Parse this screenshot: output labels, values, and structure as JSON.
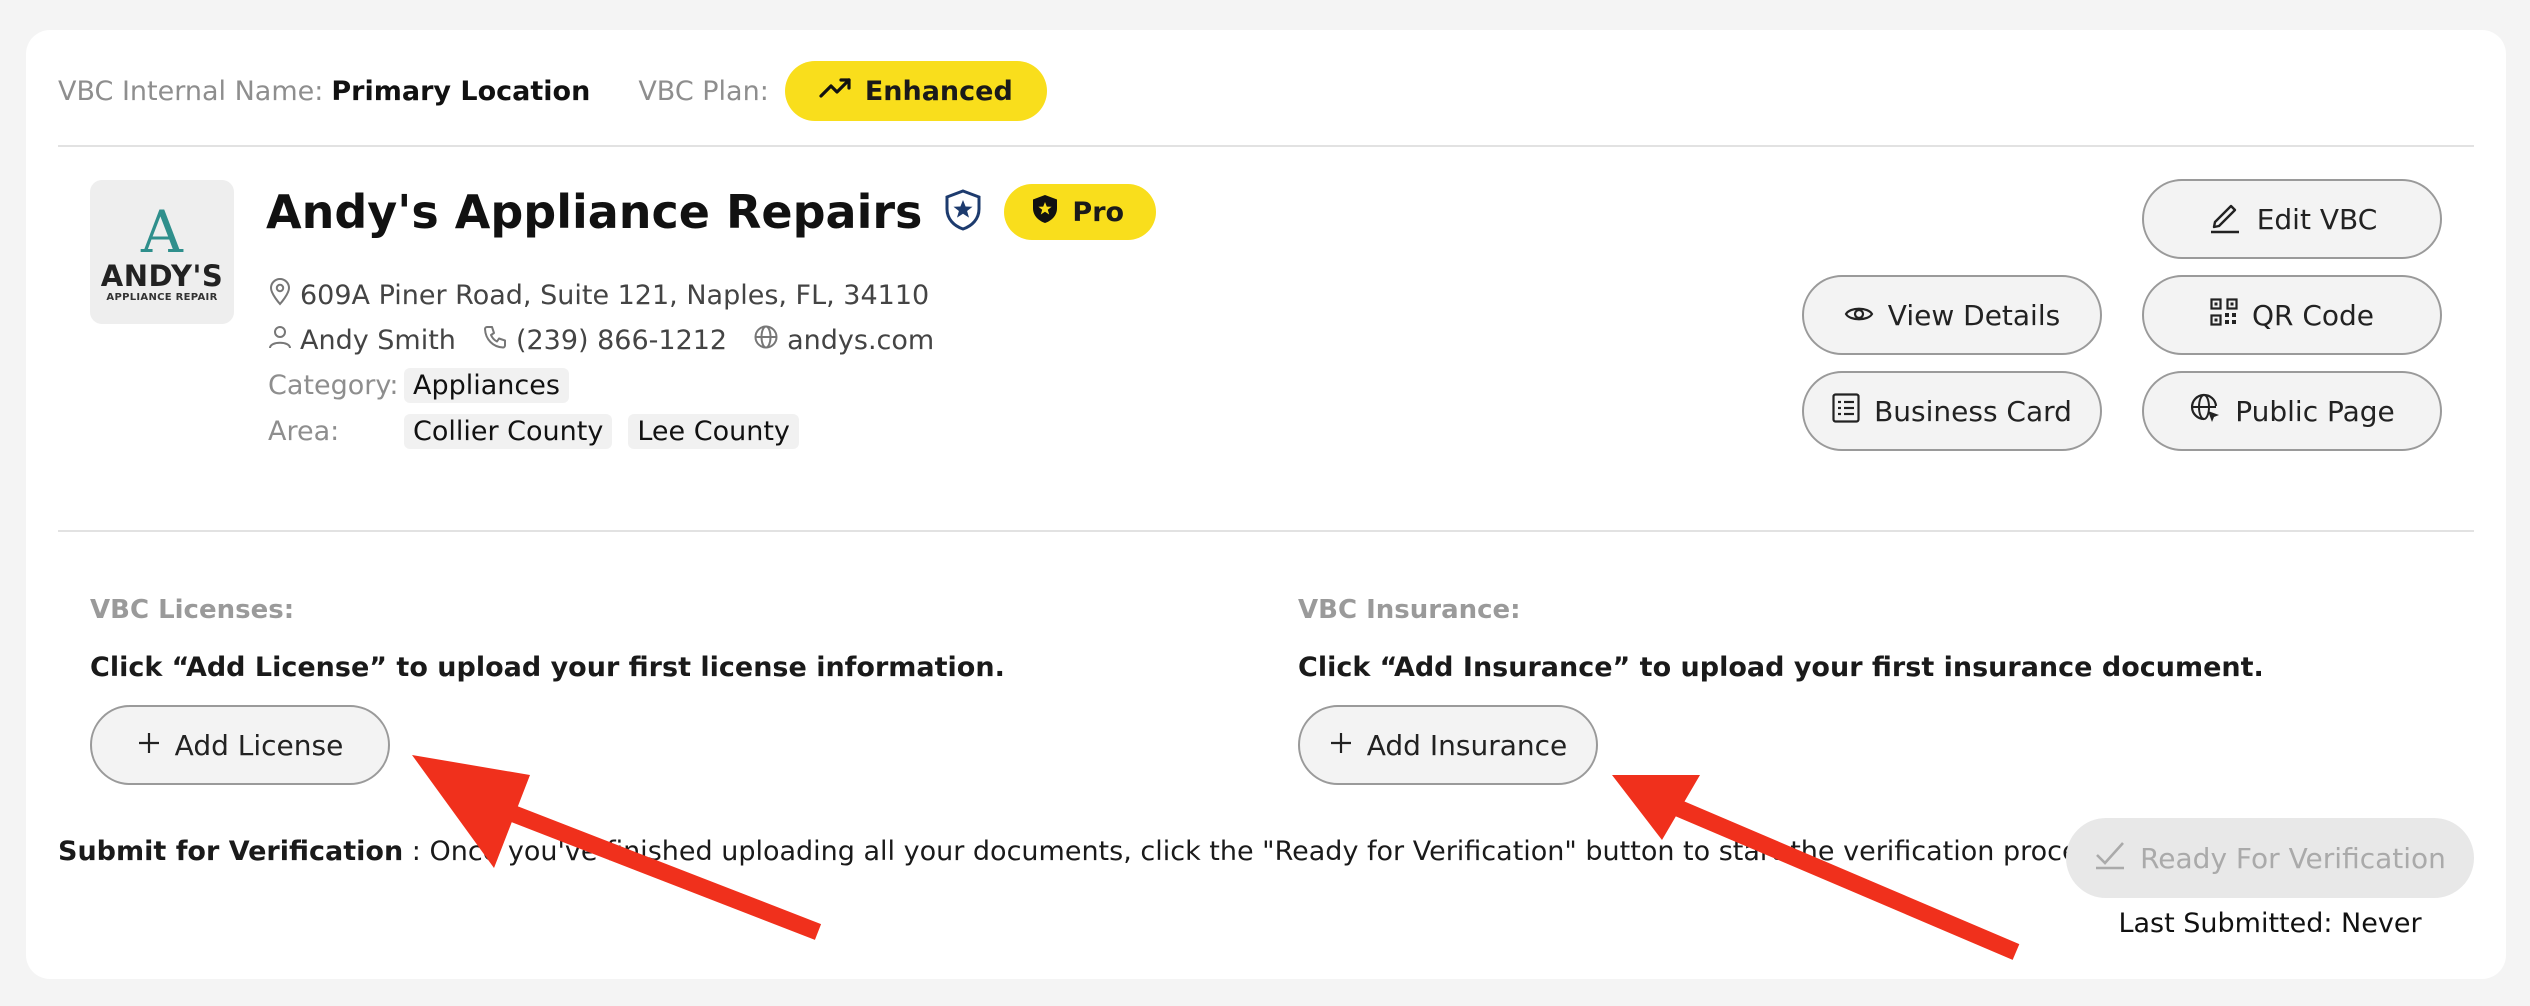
{
  "header": {
    "internal_name_label": "VBC Internal Name:",
    "internal_name_value": "Primary Location",
    "plan_label": "VBC Plan:",
    "plan_value": "Enhanced"
  },
  "business": {
    "logo_mark": "A",
    "logo_text_1": "ANDY'S",
    "logo_text_2": "APPLIANCE REPAIR",
    "name": "Andy's Appliance Repairs",
    "tier_badge": "Pro",
    "address": "609A Piner Road, Suite 121, Naples, FL, 34110",
    "contact_name": "Andy Smith",
    "phone": "(239) 866-1212",
    "website": "andys.com",
    "category_label": "Category:",
    "categories": [
      "Appliances"
    ],
    "area_label": "Area:",
    "areas": [
      "Collier County",
      "Lee County"
    ]
  },
  "actions": {
    "edit": "Edit VBC",
    "view_details": "View Details",
    "qr_code": "QR Code",
    "business_card": "Business Card",
    "public_page": "Public Page"
  },
  "licenses": {
    "label": "VBC Licenses:",
    "prompt": "Click “Add License” to upload your first license information.",
    "button": "Add License"
  },
  "insurance": {
    "label": "VBC Insurance:",
    "prompt": "Click “Add Insurance” to upload your first insurance document.",
    "button": "Add Insurance"
  },
  "verification": {
    "title": "Submit for Verification",
    "text": ": Once you've finished uploading all your documents, click the \"Ready for Verification\" button to start the verification process.",
    "button": "Ready For Verification",
    "last_submitted": "Last Submitted: Never"
  },
  "colors": {
    "badge_yellow": "#f9de1c",
    "arrow_red": "#f0301c",
    "logo_teal": "#2f8f8c"
  },
  "icons": [
    "trend-up-icon",
    "shield-star-icon",
    "shield-badge-icon",
    "location-pin-icon",
    "user-icon",
    "phone-icon",
    "globe-icon",
    "pencil-icon",
    "eye-icon",
    "qr-icon",
    "list-icon",
    "globe-cursor-icon",
    "plus-icon",
    "check-icon"
  ]
}
